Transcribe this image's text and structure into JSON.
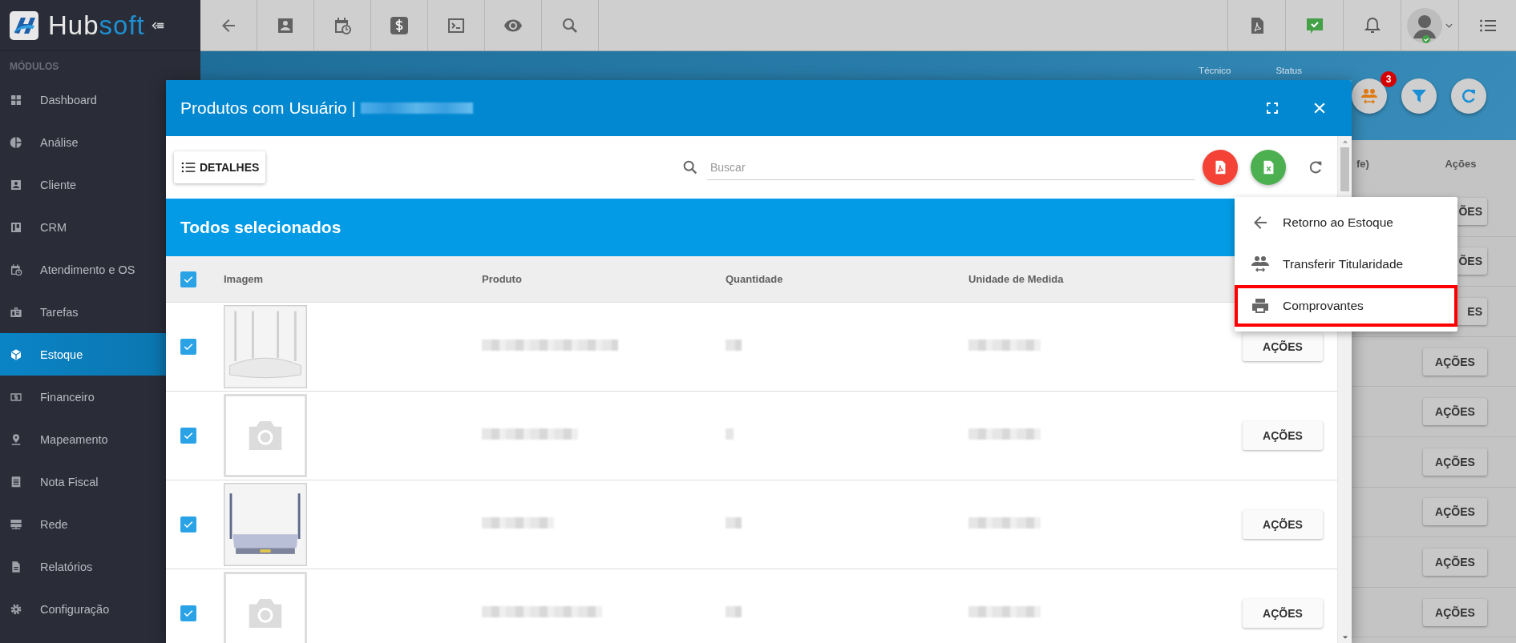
{
  "logo": {
    "part_1": "Hub",
    "part_2": "soft"
  },
  "sidebar": {
    "heading": "MÓDULOS",
    "items": [
      {
        "label": "Dashboard",
        "selected": false
      },
      {
        "label": "Análise",
        "selected": false
      },
      {
        "label": "Cliente",
        "selected": false
      },
      {
        "label": "CRM",
        "selected": false
      },
      {
        "label": "Atendimento e OS",
        "selected": false
      },
      {
        "label": "Tarefas",
        "selected": false
      },
      {
        "label": "Estoque",
        "selected": true
      },
      {
        "label": "Financeiro",
        "selected": false
      },
      {
        "label": "Mapeamento",
        "selected": false
      },
      {
        "label": "Nota Fiscal",
        "selected": false
      },
      {
        "label": "Rede",
        "selected": false
      },
      {
        "label": "Relatórios",
        "selected": false
      },
      {
        "label": "Configuração",
        "selected": false
      }
    ]
  },
  "background": {
    "filters": [
      "Técnico",
      "Status"
    ],
    "badge": "3",
    "columns": [
      "fe)",
      "Ações"
    ],
    "row_buttons": [
      "ÕES",
      "ÕES",
      "ES",
      "AÇÕES",
      "AÇÕES",
      "AÇÕES",
      "AÇÕES",
      "AÇÕES",
      "AÇÕES"
    ]
  },
  "modal": {
    "title": "Produtos com Usuário |",
    "details_button": "DETALHES",
    "search": {
      "placeholder": "Buscar"
    },
    "banner": "Todos selecionados",
    "select_all": {
      "checked": true
    },
    "columns": [
      "Imagem",
      "Produto",
      "Quantidade",
      "Unidade de Medida"
    ],
    "rows": [
      {
        "checked": true,
        "action": "AÇÕES"
      },
      {
        "checked": true,
        "image": {
          "kind": "placeholder"
        },
        "action": "AÇÕES"
      },
      {
        "checked": true,
        "action": "AÇÕES"
      },
      {
        "checked": true,
        "image": {
          "kind": "placeholder"
        },
        "action": "AÇÕES"
      }
    ]
  },
  "menu": {
    "items": [
      {
        "label": "Retorno ao Estoque",
        "highlighted": false
      },
      {
        "label": "Transferir Titularidade",
        "highlighted": false
      },
      {
        "label": "Comprovantes",
        "highlighted": true
      }
    ]
  }
}
